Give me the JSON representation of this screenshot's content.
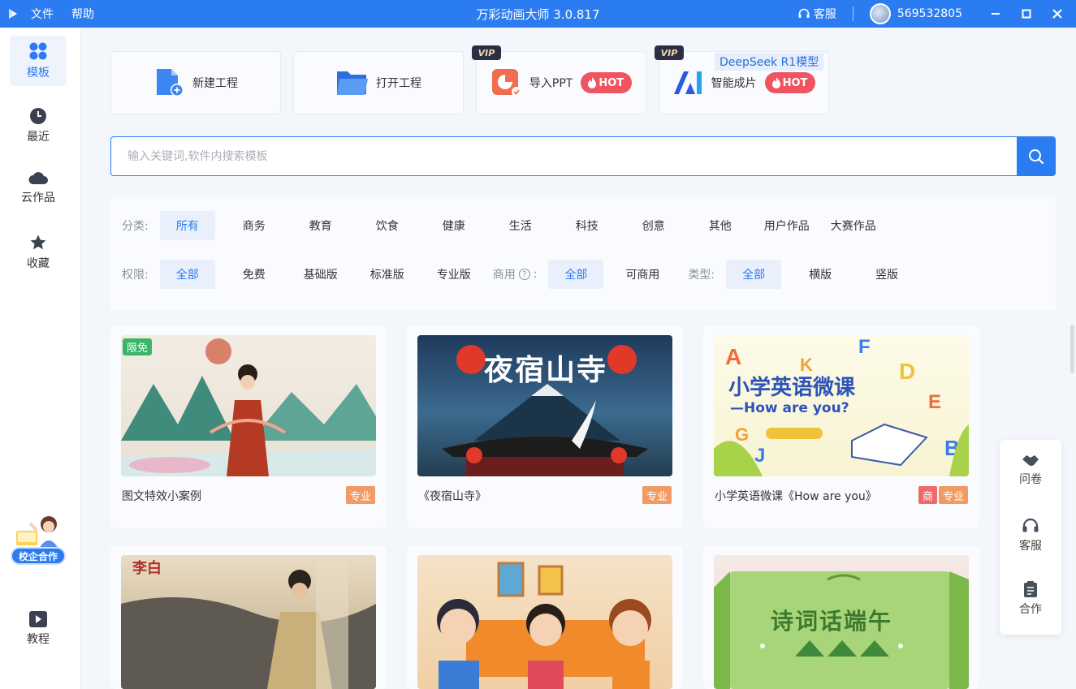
{
  "titlebar": {
    "menu": [
      "文件",
      "帮助"
    ],
    "title": "万彩动画大师 3.0.817",
    "service": "客服",
    "user_id": "569532805"
  },
  "sidebar": {
    "items": [
      "模板",
      "最近",
      "云作品",
      "收藏"
    ],
    "coop_label": "校企合作",
    "tutorial": "教程"
  },
  "cards": {
    "new_project": "新建工程",
    "open_project": "打开工程",
    "import_ppt": "导入PPT",
    "smart_film": "智能成片",
    "vip": "VIP",
    "hot": "HOT",
    "deepseek": "DeepSeek R1模型"
  },
  "search": {
    "placeholder": "输入关键词,软件内搜索模板"
  },
  "filters": {
    "category_label": "分类:",
    "categories": [
      "所有",
      "商务",
      "教育",
      "饮食",
      "健康",
      "生活",
      "科技",
      "创意",
      "其他",
      "用户作品",
      "大赛作品"
    ],
    "permission_label": "权限:",
    "permissions": [
      "全部",
      "免费",
      "基础版",
      "标准版",
      "专业版"
    ],
    "commercial_label": "商用",
    "commercial_colon": ":",
    "commercial": [
      "全部",
      "可商用"
    ],
    "type_label": "类型:",
    "types": [
      "全部",
      "横版",
      "竖版"
    ]
  },
  "templates": [
    {
      "name": "图文特效小案例",
      "badges": [
        "专业"
      ],
      "tag": "限免"
    },
    {
      "name": "《夜宿山寺》",
      "badges": [
        "专业"
      ],
      "thumb_text": "夜宿山寺"
    },
    {
      "name": "小学英语微课《How are you》",
      "badges": [
        "商",
        "专业"
      ],
      "thumb_title": "小学英语微课",
      "thumb_sub": "—How are you?"
    },
    {
      "name": "",
      "thumb_text": "李白"
    },
    {
      "name": ""
    },
    {
      "name": "",
      "thumb_text": "诗词话端午"
    }
  ],
  "right_bar": [
    "问卷",
    "客服",
    "合作"
  ],
  "colors": {
    "primary": "#2b7cf0",
    "hot": "#f05461",
    "badge_pro": "#f29a64",
    "badge_commercial": "#f06a6a",
    "free_tag": "#39b56a"
  }
}
